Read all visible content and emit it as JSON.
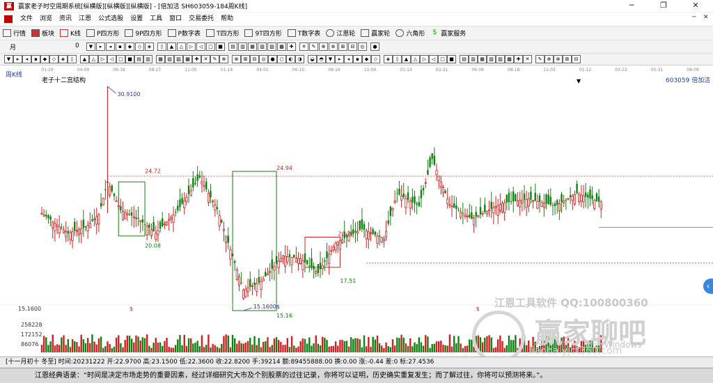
{
  "window": {
    "title": "赢家老子时空周期系统[纵横版][纵横版][纵横版] - [倍加洁  SH603059-184周K线]",
    "logo_text": "赢",
    "min_glyph": "─",
    "max_glyph": "❐",
    "close_glyph": "✕"
  },
  "menu": {
    "items": [
      "文件",
      "浏览",
      "资讯",
      "江恩",
      "公式选股",
      "设置",
      "工具",
      "窗口",
      "交易委托",
      "帮助"
    ],
    "right_min": "─",
    "right_close": "✕"
  },
  "toolbar1": {
    "items": [
      {
        "label": "行情",
        "icon": "grid-icon"
      },
      {
        "label": "板块",
        "icon": "blocks-icon"
      },
      {
        "label": "K线",
        "icon": "candle-icon"
      },
      {
        "label": "P四方形",
        "icon": "p-square-icon"
      },
      {
        "label": "9P四方形",
        "icon": "9p-square-icon"
      },
      {
        "label": "P数字表",
        "icon": "p-table-icon"
      },
      {
        "label": "T四方形",
        "icon": "t-square-icon"
      },
      {
        "label": "9T四方形",
        "icon": "9t-square-icon"
      },
      {
        "label": "T数字表",
        "icon": "t-table-icon"
      },
      {
        "label": "江恩轮",
        "icon": "gann-wheel-icon"
      },
      {
        "label": "赢家轮",
        "icon": "winner-wheel-icon"
      },
      {
        "label": "六角形",
        "icon": "hexagon-icon"
      },
      {
        "label": "赢家服务",
        "icon": "dollar-icon"
      }
    ]
  },
  "toolbar2": {
    "period_select": "月",
    "counter_value": "0"
  },
  "chart": {
    "period_label": "周K线",
    "indicator_title": "老子十二宫结构",
    "stock_label": "603059  倍加洁",
    "dropdown_glyph": "▼",
    "date_ticks": [
      "01-29",
      "04-09",
      "06-18",
      "08-27",
      "11-05",
      "01-14",
      "04-01",
      "06-10",
      "08-19",
      "11-04",
      "01-13",
      "03-31",
      "06-09",
      "08-18",
      "11-03",
      "01-12",
      "03-22",
      "05-31",
      "08-09"
    ],
    "price_labels": {
      "high": "30.9100",
      "low": "15.1600$",
      "low_short": "15.16",
      "box1_top": "24.72",
      "box1_bottom": "20.08",
      "box2_top": "24.94",
      "box3_top": "20.32",
      "box3_bottom": "17.51"
    },
    "volume_axis": {
      "top": "15.1600",
      "ticks": [
        "258228",
        "172152",
        "86076"
      ]
    },
    "markers": {
      "dollar": "$"
    },
    "watermark": {
      "tool_text": "江恩工具软件  QQ:100800360",
      "brand": "赢家聊吧",
      "win_text": "激活 Windows",
      "url_text": "liaoba.yjct360.com"
    },
    "side_button": "‹"
  },
  "chart_data": {
    "type": "candlestick",
    "title": "老子十二宫结构",
    "period": "周K线",
    "symbol": "603059",
    "name": "倍加洁",
    "x_dates": [
      "01-29",
      "04-09",
      "06-18",
      "08-27",
      "11-05",
      "01-14",
      "04-01",
      "06-10",
      "08-19",
      "11-04",
      "01-13",
      "03-31",
      "06-09",
      "08-18",
      "11-03",
      "01-12",
      "03-22",
      "05-31",
      "08-09"
    ],
    "ylim": [
      15.16,
      30.91
    ],
    "annotations": {
      "high": 30.91,
      "low": 15.16,
      "levels": [
        24.72,
        20.08,
        24.94,
        20.32,
        17.51
      ]
    },
    "volume_ticks": [
      258228,
      172152,
      86076
    ],
    "last_close": 22.82
  },
  "status": {
    "text": "[十一月初十 冬至] 时间:20231222 开:22.9700 高:23.1500 低:22.3600 收:22.8200 手:39214 额:89455888.00 换:0.00 涨:-0.44 差:0 标:27.4536"
  },
  "quote": {
    "text": "江恩经典语录：“时间是决定市场走势的重要因素，经过详细研究大市及个别股票的过往记录，你将可以证明，历史确实重复发生；而了解过往，你将可以预测将来。”。"
  },
  "colors": {
    "up": "#d02020",
    "down": "#108010",
    "dashed_red": "#d02020",
    "dashed_green": "#108010",
    "label_blue": "#3030b0"
  }
}
